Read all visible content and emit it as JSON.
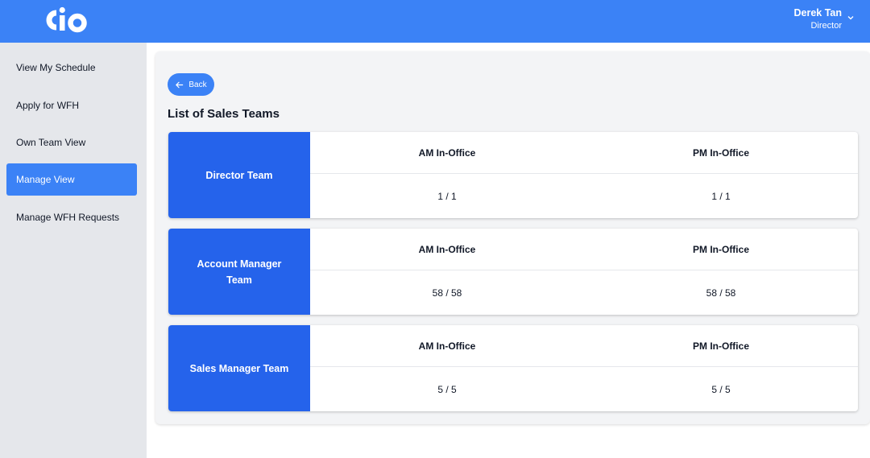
{
  "header": {
    "logo_text": "cio",
    "user_name": "Derek Tan",
    "user_role": "Director"
  },
  "sidebar": {
    "items": [
      {
        "label": "View My Schedule",
        "active": false
      },
      {
        "label": "Apply for WFH",
        "active": false
      },
      {
        "label": "Own Team View",
        "active": false
      },
      {
        "label": "Manage View",
        "active": true
      },
      {
        "label": "Manage WFH Requests",
        "active": false
      }
    ]
  },
  "main": {
    "back_label": "Back",
    "title": "List of Sales Teams",
    "teams": [
      {
        "name": "Director Team",
        "am_header": "AM In-Office",
        "pm_header": "PM In-Office",
        "am_value": "1 / 1",
        "pm_value": "1 / 1"
      },
      {
        "name": "Account Manager Team",
        "am_header": "AM In-Office",
        "pm_header": "PM In-Office",
        "am_value": "58 / 58",
        "pm_value": "58 / 58"
      },
      {
        "name": "Sales Manager Team",
        "am_header": "AM In-Office",
        "pm_header": "PM In-Office",
        "am_value": "5 / 5",
        "pm_value": "5 / 5"
      }
    ]
  },
  "colors": {
    "header": "#3b82f6",
    "sidebar": "#e5e7eb",
    "active_item": "#3b82f6",
    "team_label": "#2563eb"
  }
}
